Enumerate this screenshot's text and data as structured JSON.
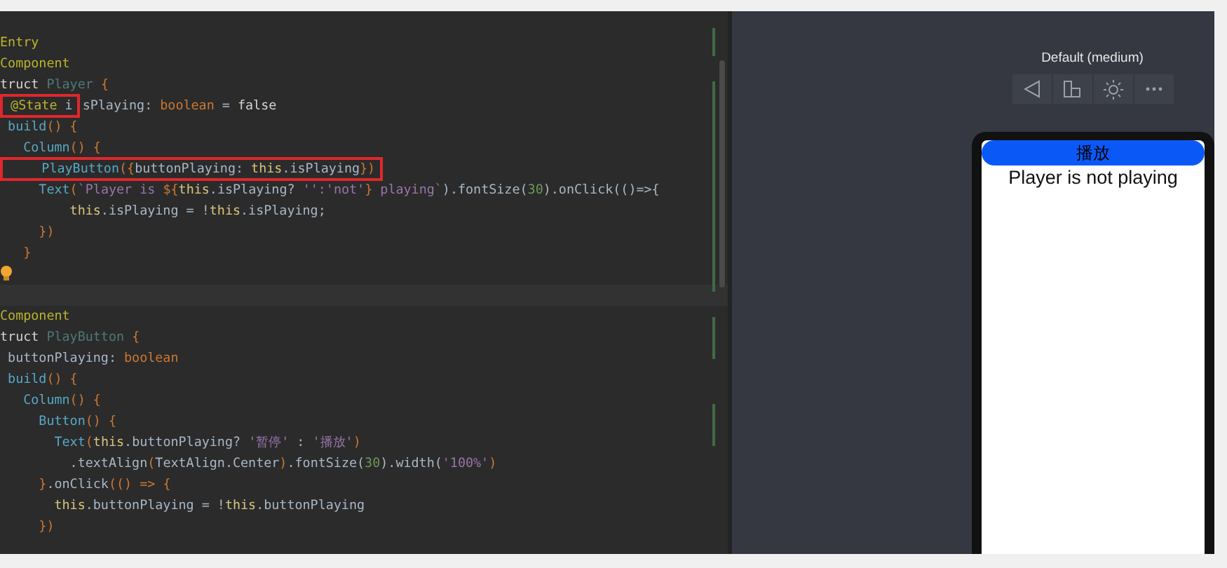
{
  "editor": {
    "lines": [
      {
        "kind": "code",
        "tokens": [
          {
            "text": "Entry",
            "kind": "annotation"
          }
        ]
      },
      {
        "kind": "code",
        "tokens": [
          {
            "text": "Component",
            "kind": "annotation"
          }
        ]
      },
      {
        "kind": "code",
        "tokens": [
          {
            "text": "truct",
            "kind": "keyword"
          },
          {
            "text": " Player ",
            "kind": "struct"
          },
          {
            "text": "{",
            "kind": "brace"
          }
        ]
      },
      {
        "kind": "code",
        "tokens": [
          {
            "kind": "box",
            "tokens": [
              {
                "text": " @State",
                "kind": "annotation"
              },
              {
                "text": " i",
                "kind": "plain"
              }
            ]
          },
          {
            "text": "sPlaying: ",
            "kind": "plain"
          },
          {
            "text": "boolean",
            "kind": "type"
          },
          {
            "text": " = ",
            "kind": "plain"
          },
          {
            "text": "false",
            "kind": "keyword"
          }
        ]
      },
      {
        "kind": "code",
        "tokens": [
          {
            "text": " build",
            "kind": "call"
          },
          {
            "text": "() {",
            "kind": "brace"
          }
        ]
      },
      {
        "kind": "code",
        "tokens": [
          {
            "text": "   Column",
            "kind": "call"
          },
          {
            "text": "() {",
            "kind": "brace"
          }
        ]
      },
      {
        "kind": "code",
        "tokens": [
          {
            "kind": "box",
            "tokens": [
              {
                "text": "     PlayButton",
                "kind": "call"
              },
              {
                "text": "({",
                "kind": "brace"
              },
              {
                "text": "buttonPlaying: ",
                "kind": "plain"
              },
              {
                "text": "this",
                "kind": "this"
              },
              {
                "text": ".isPlaying",
                "kind": "plain"
              },
              {
                "text": "})",
                "kind": "brace"
              }
            ]
          }
        ]
      },
      {
        "kind": "code",
        "tokens": [
          {
            "text": "     Text",
            "kind": "call"
          },
          {
            "text": "(",
            "kind": "brace"
          },
          {
            "text": "`Player is ",
            "kind": "string"
          },
          {
            "text": "${",
            "kind": "brace"
          },
          {
            "text": "this",
            "kind": "this"
          },
          {
            "text": ".isPlaying? ",
            "kind": "plain"
          },
          {
            "text": "'':'not'",
            "kind": "string"
          },
          {
            "text": "}",
            "kind": "brace"
          },
          {
            "text": " playing`",
            "kind": "string"
          },
          {
            "text": ").fontSize(",
            "kind": "plain"
          },
          {
            "text": "30",
            "kind": "number"
          },
          {
            "text": ").onClick(()=>{",
            "kind": "plain"
          }
        ]
      },
      {
        "kind": "code",
        "tokens": [
          {
            "text": "         this",
            "kind": "this"
          },
          {
            "text": ".isPlaying = !",
            "kind": "plain"
          },
          {
            "text": "this",
            "kind": "this"
          },
          {
            "text": ".isPlaying;",
            "kind": "plain"
          }
        ]
      },
      {
        "kind": "code",
        "tokens": [
          {
            "text": "     })",
            "kind": "brace"
          }
        ]
      },
      {
        "kind": "code",
        "tokens": [
          {
            "text": "   }",
            "kind": "brace"
          }
        ]
      },
      {
        "kind": "bulb"
      },
      {
        "kind": "current-line"
      },
      {
        "kind": "code",
        "tokens": [
          {
            "text": "Component",
            "kind": "annotation"
          }
        ]
      },
      {
        "kind": "code",
        "tokens": [
          {
            "text": "truct",
            "kind": "keyword"
          },
          {
            "text": " PlayButton ",
            "kind": "struct"
          },
          {
            "text": "{",
            "kind": "brace"
          }
        ]
      },
      {
        "kind": "code",
        "tokens": [
          {
            "text": " buttonPlaying: ",
            "kind": "plain"
          },
          {
            "text": "boolean",
            "kind": "type"
          }
        ]
      },
      {
        "kind": "code",
        "tokens": [
          {
            "text": " build",
            "kind": "call"
          },
          {
            "text": "() {",
            "kind": "brace"
          }
        ]
      },
      {
        "kind": "code",
        "tokens": [
          {
            "text": "   Column",
            "kind": "call"
          },
          {
            "text": "() {",
            "kind": "brace"
          }
        ]
      },
      {
        "kind": "code",
        "tokens": [
          {
            "text": "     Button",
            "kind": "call"
          },
          {
            "text": "() {",
            "kind": "brace"
          }
        ]
      },
      {
        "kind": "code",
        "tokens": [
          {
            "text": "       Text",
            "kind": "call"
          },
          {
            "text": "(",
            "kind": "brace"
          },
          {
            "text": "this",
            "kind": "this"
          },
          {
            "text": ".buttonPlaying? ",
            "kind": "plain"
          },
          {
            "text": "'暂停'",
            "kind": "string"
          },
          {
            "text": " : ",
            "kind": "plain"
          },
          {
            "text": "'播放'",
            "kind": "string"
          },
          {
            "text": ")",
            "kind": "brace"
          }
        ]
      },
      {
        "kind": "code",
        "tokens": [
          {
            "text": "         .textAlign",
            "kind": "plain"
          },
          {
            "text": "(",
            "kind": "brace"
          },
          {
            "text": "TextAlign.Center",
            "kind": "plain"
          },
          {
            "text": ")",
            "kind": "brace"
          },
          {
            "text": ".fontSize(",
            "kind": "plain"
          },
          {
            "text": "30",
            "kind": "number"
          },
          {
            "text": ").width(",
            "kind": "plain"
          },
          {
            "text": "'100%'",
            "kind": "string"
          },
          {
            "text": ")",
            "kind": "brace"
          }
        ]
      },
      {
        "kind": "code",
        "tokens": [
          {
            "text": "     }",
            "kind": "brace"
          },
          {
            "text": ".onClick",
            "kind": "plain"
          },
          {
            "text": "(() => {",
            "kind": "brace"
          }
        ]
      },
      {
        "kind": "code",
        "tokens": [
          {
            "text": "       this",
            "kind": "this"
          },
          {
            "text": ".buttonPlaying = !",
            "kind": "plain"
          },
          {
            "text": "this",
            "kind": "this"
          },
          {
            "text": ".buttonPlaying",
            "kind": "plain"
          }
        ]
      },
      {
        "kind": "code",
        "tokens": [
          {
            "text": "     })",
            "kind": "brace"
          }
        ]
      }
    ]
  },
  "preview": {
    "device": "Default (medium)",
    "button": {
      "label": "播放"
    },
    "status_text": "Player is not playing"
  }
}
